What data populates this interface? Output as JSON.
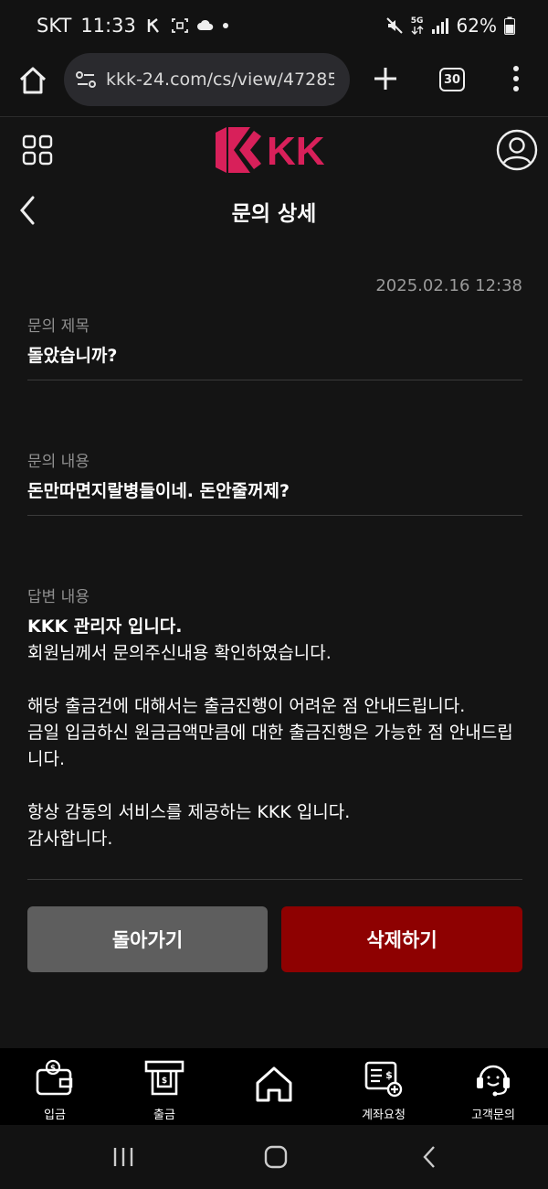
{
  "status_bar": {
    "carrier": "SKT",
    "time": "11:33",
    "battery": "62%",
    "network": "5G"
  },
  "browser": {
    "url": "kkk-24.com/cs/view/47285",
    "tab_count": "30"
  },
  "site": {
    "logo_text": "KK",
    "brand_color": "#d8205a"
  },
  "page": {
    "title": "문의 상세"
  },
  "inquiry": {
    "timestamp": "2025.02.16 12:38",
    "subject_label": "문의 제목",
    "subject_value": "돌았습니까?",
    "content_label": "문의 내용",
    "content_value": "돈만따면지랄병들이네. 돈안줄꺼제?",
    "answer_label": "답변 내용",
    "answer_lines": {
      "l1": "KKK 관리자 입니다.",
      "l2": "회원님께서 문의주신내용 확인하였습니다.",
      "l3": "해당 출금건에 대해서는 출금진행이 어려운 점 안내드립니다.",
      "l4": "금일 입금하신 원금금액만큼에 대한 출금진행은 가능한 점 안내드립니다.",
      "l5": "항상 감동의 서비스를 제공하는 KKK 입니다.",
      "l6": "감사합니다."
    }
  },
  "actions": {
    "back_label": "돌아가기",
    "delete_label": "삭제하기"
  },
  "bottom_nav": {
    "deposit": "입금",
    "withdraw": "출금",
    "home": "",
    "account_request": "계좌요청",
    "support": "고객문의"
  }
}
